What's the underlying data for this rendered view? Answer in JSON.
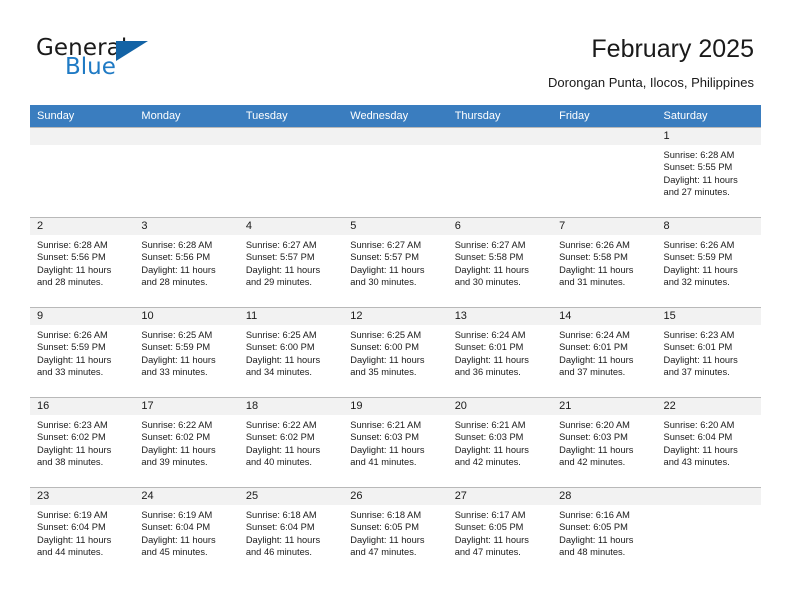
{
  "brand": {
    "name_part1": "General",
    "name_part2": "Blue",
    "accent_color": "#1363a5",
    "blue_text_color": "#1f7ac4",
    "logo_icon": "triangle-logo-icon"
  },
  "header": {
    "title": "February 2025",
    "subtitle": "Dorongan Punta, Ilocos, Philippines"
  },
  "calendar": {
    "header_background": "#3a7dbf",
    "header_text_color": "#ffffff",
    "daynum_background": "#f2f2f2",
    "border_color": "#b9b9b9",
    "weekday_headers": [
      "Sunday",
      "Monday",
      "Tuesday",
      "Wednesday",
      "Thursday",
      "Friday",
      "Saturday"
    ],
    "weeks": [
      [
        {
          "day": "",
          "empty": true,
          "sunrise": "",
          "sunset": "",
          "daylight_line1": "",
          "daylight_line2": ""
        },
        {
          "day": "",
          "empty": true,
          "sunrise": "",
          "sunset": "",
          "daylight_line1": "",
          "daylight_line2": ""
        },
        {
          "day": "",
          "empty": true,
          "sunrise": "",
          "sunset": "",
          "daylight_line1": "",
          "daylight_line2": ""
        },
        {
          "day": "",
          "empty": true,
          "sunrise": "",
          "sunset": "",
          "daylight_line1": "",
          "daylight_line2": ""
        },
        {
          "day": "",
          "empty": true,
          "sunrise": "",
          "sunset": "",
          "daylight_line1": "",
          "daylight_line2": ""
        },
        {
          "day": "",
          "empty": true,
          "sunrise": "",
          "sunset": "",
          "daylight_line1": "",
          "daylight_line2": ""
        },
        {
          "day": "1",
          "empty": false,
          "sunrise": "Sunrise: 6:28 AM",
          "sunset": "Sunset: 5:55 PM",
          "daylight_line1": "Daylight: 11 hours",
          "daylight_line2": "and 27 minutes."
        }
      ],
      [
        {
          "day": "2",
          "empty": false,
          "sunrise": "Sunrise: 6:28 AM",
          "sunset": "Sunset: 5:56 PM",
          "daylight_line1": "Daylight: 11 hours",
          "daylight_line2": "and 28 minutes."
        },
        {
          "day": "3",
          "empty": false,
          "sunrise": "Sunrise: 6:28 AM",
          "sunset": "Sunset: 5:56 PM",
          "daylight_line1": "Daylight: 11 hours",
          "daylight_line2": "and 28 minutes."
        },
        {
          "day": "4",
          "empty": false,
          "sunrise": "Sunrise: 6:27 AM",
          "sunset": "Sunset: 5:57 PM",
          "daylight_line1": "Daylight: 11 hours",
          "daylight_line2": "and 29 minutes."
        },
        {
          "day": "5",
          "empty": false,
          "sunrise": "Sunrise: 6:27 AM",
          "sunset": "Sunset: 5:57 PM",
          "daylight_line1": "Daylight: 11 hours",
          "daylight_line2": "and 30 minutes."
        },
        {
          "day": "6",
          "empty": false,
          "sunrise": "Sunrise: 6:27 AM",
          "sunset": "Sunset: 5:58 PM",
          "daylight_line1": "Daylight: 11 hours",
          "daylight_line2": "and 30 minutes."
        },
        {
          "day": "7",
          "empty": false,
          "sunrise": "Sunrise: 6:26 AM",
          "sunset": "Sunset: 5:58 PM",
          "daylight_line1": "Daylight: 11 hours",
          "daylight_line2": "and 31 minutes."
        },
        {
          "day": "8",
          "empty": false,
          "sunrise": "Sunrise: 6:26 AM",
          "sunset": "Sunset: 5:59 PM",
          "daylight_line1": "Daylight: 11 hours",
          "daylight_line2": "and 32 minutes."
        }
      ],
      [
        {
          "day": "9",
          "empty": false,
          "sunrise": "Sunrise: 6:26 AM",
          "sunset": "Sunset: 5:59 PM",
          "daylight_line1": "Daylight: 11 hours",
          "daylight_line2": "and 33 minutes."
        },
        {
          "day": "10",
          "empty": false,
          "sunrise": "Sunrise: 6:25 AM",
          "sunset": "Sunset: 5:59 PM",
          "daylight_line1": "Daylight: 11 hours",
          "daylight_line2": "and 33 minutes."
        },
        {
          "day": "11",
          "empty": false,
          "sunrise": "Sunrise: 6:25 AM",
          "sunset": "Sunset: 6:00 PM",
          "daylight_line1": "Daylight: 11 hours",
          "daylight_line2": "and 34 minutes."
        },
        {
          "day": "12",
          "empty": false,
          "sunrise": "Sunrise: 6:25 AM",
          "sunset": "Sunset: 6:00 PM",
          "daylight_line1": "Daylight: 11 hours",
          "daylight_line2": "and 35 minutes."
        },
        {
          "day": "13",
          "empty": false,
          "sunrise": "Sunrise: 6:24 AM",
          "sunset": "Sunset: 6:01 PM",
          "daylight_line1": "Daylight: 11 hours",
          "daylight_line2": "and 36 minutes."
        },
        {
          "day": "14",
          "empty": false,
          "sunrise": "Sunrise: 6:24 AM",
          "sunset": "Sunset: 6:01 PM",
          "daylight_line1": "Daylight: 11 hours",
          "daylight_line2": "and 37 minutes."
        },
        {
          "day": "15",
          "empty": false,
          "sunrise": "Sunrise: 6:23 AM",
          "sunset": "Sunset: 6:01 PM",
          "daylight_line1": "Daylight: 11 hours",
          "daylight_line2": "and 37 minutes."
        }
      ],
      [
        {
          "day": "16",
          "empty": false,
          "sunrise": "Sunrise: 6:23 AM",
          "sunset": "Sunset: 6:02 PM",
          "daylight_line1": "Daylight: 11 hours",
          "daylight_line2": "and 38 minutes."
        },
        {
          "day": "17",
          "empty": false,
          "sunrise": "Sunrise: 6:22 AM",
          "sunset": "Sunset: 6:02 PM",
          "daylight_line1": "Daylight: 11 hours",
          "daylight_line2": "and 39 minutes."
        },
        {
          "day": "18",
          "empty": false,
          "sunrise": "Sunrise: 6:22 AM",
          "sunset": "Sunset: 6:02 PM",
          "daylight_line1": "Daylight: 11 hours",
          "daylight_line2": "and 40 minutes."
        },
        {
          "day": "19",
          "empty": false,
          "sunrise": "Sunrise: 6:21 AM",
          "sunset": "Sunset: 6:03 PM",
          "daylight_line1": "Daylight: 11 hours",
          "daylight_line2": "and 41 minutes."
        },
        {
          "day": "20",
          "empty": false,
          "sunrise": "Sunrise: 6:21 AM",
          "sunset": "Sunset: 6:03 PM",
          "daylight_line1": "Daylight: 11 hours",
          "daylight_line2": "and 42 minutes."
        },
        {
          "day": "21",
          "empty": false,
          "sunrise": "Sunrise: 6:20 AM",
          "sunset": "Sunset: 6:03 PM",
          "daylight_line1": "Daylight: 11 hours",
          "daylight_line2": "and 42 minutes."
        },
        {
          "day": "22",
          "empty": false,
          "sunrise": "Sunrise: 6:20 AM",
          "sunset": "Sunset: 6:04 PM",
          "daylight_line1": "Daylight: 11 hours",
          "daylight_line2": "and 43 minutes."
        }
      ],
      [
        {
          "day": "23",
          "empty": false,
          "sunrise": "Sunrise: 6:19 AM",
          "sunset": "Sunset: 6:04 PM",
          "daylight_line1": "Daylight: 11 hours",
          "daylight_line2": "and 44 minutes."
        },
        {
          "day": "24",
          "empty": false,
          "sunrise": "Sunrise: 6:19 AM",
          "sunset": "Sunset: 6:04 PM",
          "daylight_line1": "Daylight: 11 hours",
          "daylight_line2": "and 45 minutes."
        },
        {
          "day": "25",
          "empty": false,
          "sunrise": "Sunrise: 6:18 AM",
          "sunset": "Sunset: 6:04 PM",
          "daylight_line1": "Daylight: 11 hours",
          "daylight_line2": "and 46 minutes."
        },
        {
          "day": "26",
          "empty": false,
          "sunrise": "Sunrise: 6:18 AM",
          "sunset": "Sunset: 6:05 PM",
          "daylight_line1": "Daylight: 11 hours",
          "daylight_line2": "and 47 minutes."
        },
        {
          "day": "27",
          "empty": false,
          "sunrise": "Sunrise: 6:17 AM",
          "sunset": "Sunset: 6:05 PM",
          "daylight_line1": "Daylight: 11 hours",
          "daylight_line2": "and 47 minutes."
        },
        {
          "day": "28",
          "empty": false,
          "sunrise": "Sunrise: 6:16 AM",
          "sunset": "Sunset: 6:05 PM",
          "daylight_line1": "Daylight: 11 hours",
          "daylight_line2": "and 48 minutes."
        },
        {
          "day": "",
          "empty": true,
          "sunrise": "",
          "sunset": "",
          "daylight_line1": "",
          "daylight_line2": ""
        }
      ]
    ]
  }
}
